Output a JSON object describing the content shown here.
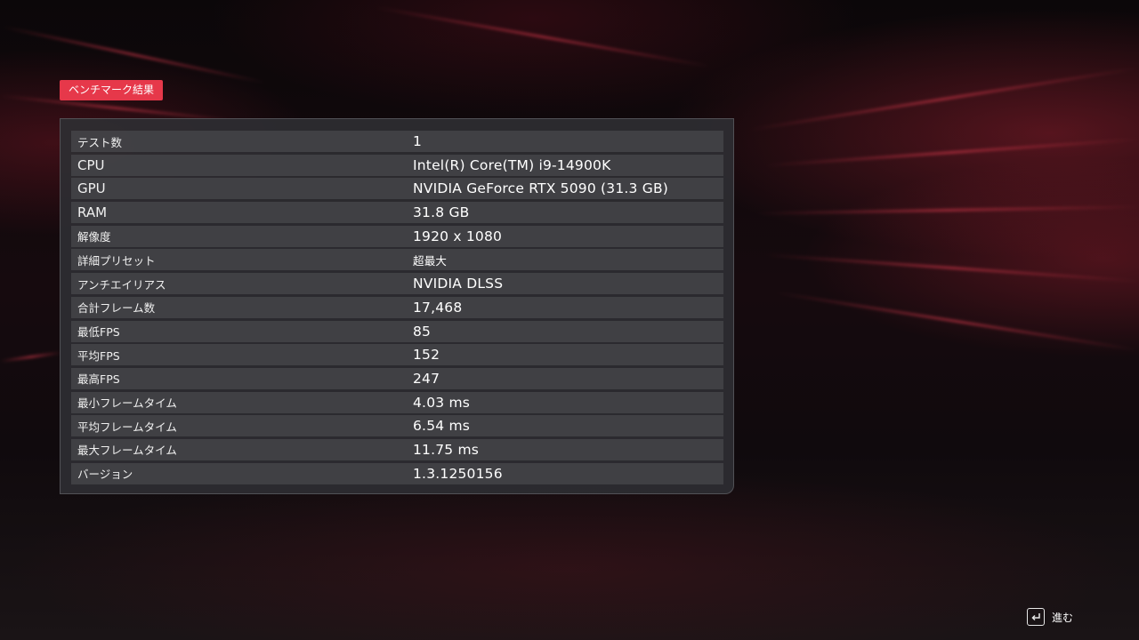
{
  "header": {
    "title": "ベンチマーク結果"
  },
  "results": [
    {
      "label": "テスト数",
      "value": "1"
    },
    {
      "label": "CPU",
      "value": "Intel(R) Core(TM) i9-14900K"
    },
    {
      "label": "GPU",
      "value": "NVIDIA GeForce RTX 5090 (31.3 GB)"
    },
    {
      "label": "RAM",
      "value": "31.8 GB"
    },
    {
      "label": "解像度",
      "value": "1920 x 1080"
    },
    {
      "label": "詳細プリセット",
      "value": "超最大"
    },
    {
      "label": "アンチエイリアス",
      "value": "NVIDIA DLSS"
    },
    {
      "label": "合計フレーム数",
      "value": "17,468"
    },
    {
      "label": "最低FPS",
      "value": "85"
    },
    {
      "label": "平均FPS",
      "value": "152"
    },
    {
      "label": "最高FPS",
      "value": "247"
    },
    {
      "label": "最小フレームタイム",
      "value": "4.03 ms"
    },
    {
      "label": "平均フレームタイム",
      "value": "6.54 ms"
    },
    {
      "label": "最大フレームタイム",
      "value": "11.75 ms"
    },
    {
      "label": "バージョン",
      "value": "1.3.1250156"
    }
  ],
  "footer": {
    "next_label": "進む",
    "next_icon": "enter-key-icon"
  },
  "colors": {
    "accent": "#e6384a",
    "panel": "#2e2e32",
    "row": "#444448"
  }
}
